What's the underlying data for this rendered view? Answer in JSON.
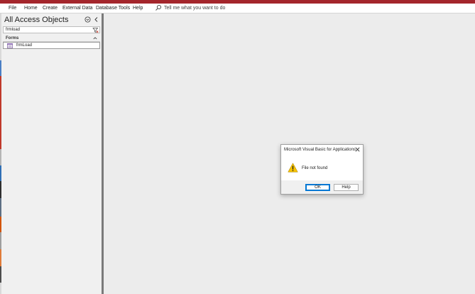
{
  "ribbon": {
    "menu": [
      "File",
      "Home",
      "Create",
      "External Data",
      "Database Tools",
      "Help"
    ],
    "tell_me": "Tell me what you want to do"
  },
  "nav": {
    "title": "All Access Objects",
    "search_value": "frmload",
    "group_label": "Forms",
    "items": [
      {
        "label": "frmLoad"
      }
    ]
  },
  "dialog": {
    "title": "Microsoft Visual Basic for Applications",
    "message": "File not found",
    "ok_label": "OK",
    "help_label": "Help"
  },
  "colors": {
    "accent_red": "#a4262c",
    "ok_focus": "#0078d4",
    "warning_yellow": "#f7c300"
  },
  "icons": [
    "search-icon",
    "nav-menu-icon",
    "collapse-chevron-icon",
    "filter-icon",
    "chevron-up-icon",
    "form-icon",
    "close-icon",
    "warning-icon"
  ]
}
